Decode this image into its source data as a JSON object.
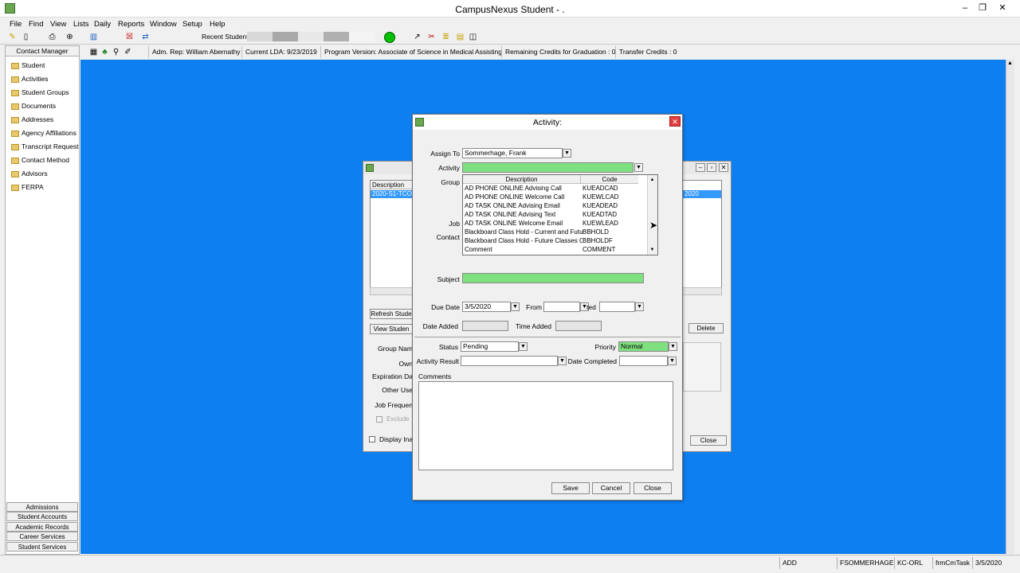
{
  "window": {
    "title": "CampusNexus Student - .",
    "controls": [
      "–",
      "❐",
      "✕"
    ]
  },
  "menu": [
    "File",
    "Find",
    "View",
    "Lists",
    "Daily",
    "Reports",
    "Window",
    "Setup",
    "Help"
  ],
  "toolbar": {
    "recent_student_label": "Recent Student"
  },
  "infobar": {
    "adm_rep": "Adm. Rep: William Abernathy",
    "current_lda": "Current LDA: 9/23/2019",
    "program_version": "Program Version: Associate of Science in Medical Assisting",
    "remaining_credits": "Remaining Credits for Graduation : 0",
    "transfer_credits": "Transfer Credits : 0"
  },
  "left_panel": {
    "header": "Contact Manager",
    "items": [
      "Student",
      "Activities",
      "Student Groups",
      "Documents",
      "Addresses",
      "Agency Affiliations",
      "Transcript Request",
      "Contact Method",
      "Advisors",
      "FERPA"
    ],
    "nav_buttons": [
      "Admissions",
      "Student Accounts",
      "Academic Records",
      "Career Services",
      "Student Services"
    ]
  },
  "bg_window": {
    "column_header": "Description",
    "selected_row": "2020-S1-TCO",
    "right_selected": "2020",
    "refresh_button": "Refresh Stude",
    "view_button": "View Studen",
    "delete_button": "Delete",
    "labels": [
      "Group Nam",
      "Own",
      "Expiration Da",
      "Other Use",
      "Job Frequen",
      "Exclude"
    ],
    "display_inactive": "Display Ina",
    "close_button": "Close"
  },
  "dialog": {
    "title": "Activity:",
    "assign_to_label": "Assign To",
    "assign_to_value": "Sommerhage, Frank",
    "activity_label": "Activity",
    "group_label": "Group",
    "job_label": "Job",
    "contact_label": "Contact",
    "list_headers": {
      "description": "Description",
      "code": "Code"
    },
    "list_rows": [
      {
        "description": "AD PHONE ONLINE Advising Call",
        "code": "KUEADCAD"
      },
      {
        "description": "AD PHONE ONLINE Welcome Call",
        "code": "KUEWLCAD"
      },
      {
        "description": "AD TASK ONLINE Advising Email",
        "code": "KUEADEAD"
      },
      {
        "description": "AD TASK ONLINE Advising Text",
        "code": "KUEADTAD"
      },
      {
        "description": "AD TASK ONLINE Welcome Email",
        "code": "KUEWLEAD"
      },
      {
        "description": "Blackboard Class Hold - Current and Futu",
        "code": "BBHOLD"
      },
      {
        "description": "Blackboard Class Hold - Future Classes O",
        "code": "BBHOLDF"
      },
      {
        "description": "Comment",
        "code": "COMMENT"
      }
    ],
    "subject_label": "Subject",
    "due_date_label": "Due Date",
    "due_date_value": "3/5/2020",
    "from_label": "From",
    "to_label": "ted",
    "date_added_label": "Date Added",
    "time_added_label": "Time Added",
    "status_label": "Status",
    "status_value": "Pending",
    "priority_label": "Priority",
    "priority_value": "Normal",
    "activity_result_label": "Activity Result",
    "date_completed_label": "Date Completed",
    "comments_label": "Comments",
    "save_button": "Save",
    "cancel_button": "Cancel",
    "close_button": "Close"
  },
  "statusbar": {
    "mode": "ADD",
    "user": "FSOMMERHAGE",
    "campus": "KC-ORL",
    "form": "frmCmTask",
    "date": "3/5/2020"
  },
  "colors": {
    "desktop": "#0d7ff1",
    "required_field": "#7fe07f"
  }
}
